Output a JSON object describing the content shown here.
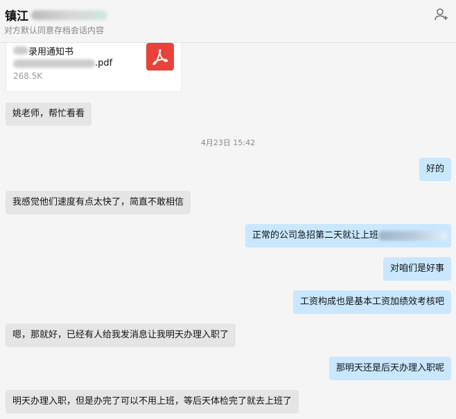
{
  "header": {
    "title": "镇江",
    "subtitle": "对方默认同意存档会话内容",
    "add_member_icon": "add-user-icon"
  },
  "file": {
    "name_line1": "录用通知书",
    "name_line2": ".pdf",
    "size": "268.5K",
    "icon": "pdf-icon"
  },
  "timestamp": "4月23日 15:42",
  "messages": [
    {
      "dir": "in",
      "text": "姚老师，帮忙看看"
    },
    {
      "dir": "out",
      "text": "好的"
    },
    {
      "dir": "in",
      "text": "我感觉他们速度有点太快了，简直不敢相信"
    },
    {
      "dir": "out",
      "text": "正常的公司急招第二天就让上班"
    },
    {
      "dir": "out",
      "text": "对咱们是好事"
    },
    {
      "dir": "out",
      "text": "工资构成也是基本工资加绩效考核吧"
    },
    {
      "dir": "in",
      "text": "嗯，那就好，已经有人给我发消息让我明天办理入职了"
    },
    {
      "dir": "out",
      "text": "那明天还是后天办理入职呢"
    },
    {
      "dir": "in",
      "text": "明天办理入职，但是办完了可以不用上班，等后天体检完了就去上班了"
    }
  ],
  "colors": {
    "incoming": "#e5e5e5",
    "outgoing": "#c9e7ff",
    "pdf": "#e8423a"
  }
}
